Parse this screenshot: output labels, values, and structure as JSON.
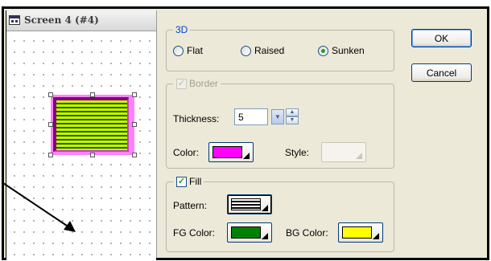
{
  "screen": {
    "title": "Screen 4 (#4)",
    "icon": "window-icon"
  },
  "sample_object": {
    "fill_pattern": "horizontal-lines",
    "fg_color": "#1a6a00",
    "bg_color": "#c8f000",
    "border_color": "#ff80ff",
    "frame_color": "#800080"
  },
  "dialog": {
    "group_3d": {
      "legend": "3D",
      "options": [
        {
          "label": "Flat",
          "selected": false
        },
        {
          "label": "Raised",
          "selected": false
        },
        {
          "label": "Sunken",
          "selected": true
        }
      ]
    },
    "group_border": {
      "legend": "Border",
      "checked": true,
      "enabled": false,
      "thickness_label": "Thickness:",
      "thickness_value": "5",
      "color_label": "Color:",
      "color_value": "#ff00ff",
      "style_label": "Style:"
    },
    "group_fill": {
      "legend": "Fill",
      "checked": true,
      "pattern_label": "Pattern:",
      "fg_label": "FG Color:",
      "fg_value": "#008000",
      "bg_label": "BG Color:",
      "bg_value": "#ffff00"
    },
    "buttons": {
      "ok": "OK",
      "cancel": "Cancel"
    }
  },
  "colors": {
    "dialog_bg": "#ece9d8",
    "legend_blue": "#0046d5",
    "disabled_text": "#a0a094"
  }
}
